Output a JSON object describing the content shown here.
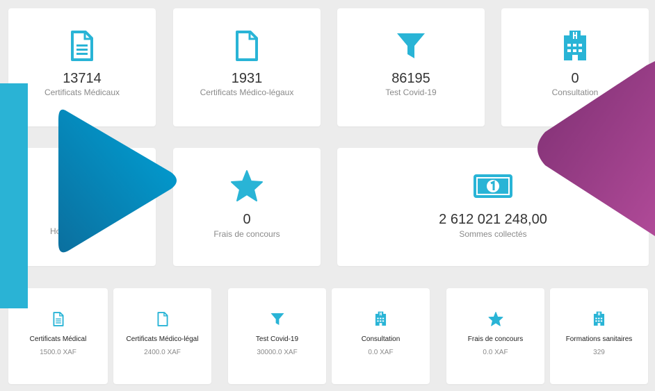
{
  "colors": {
    "accent": "#29b4d6",
    "blue_arrow": "#0088bb",
    "purple_arrow": "#9c3f86",
    "side_bar": "#2ab3d5"
  },
  "top_cards": [
    {
      "icon": "document-text-icon",
      "value": "13714",
      "label": "Certificats Médicaux"
    },
    {
      "icon": "document-icon",
      "value": "1931",
      "label": "Certificats Médico-légaux"
    },
    {
      "icon": "filter-icon",
      "value": "86195",
      "label": "Test Covid-19"
    },
    {
      "icon": "hospital-icon",
      "value": "0",
      "label": "Consultation"
    }
  ],
  "middle_cards": [
    {
      "label": "Ho"
    },
    {
      "icon": "star-icon",
      "value": "0",
      "label": "Frais de concours"
    },
    {
      "icon": "money-bill-icon",
      "value": "2 612 021 248,00",
      "label": "Sommes collectés"
    }
  ],
  "bottom_cards": [
    {
      "icon": "document-text-icon",
      "label": "Certificats Médical",
      "value": "1500.0 XAF"
    },
    {
      "icon": "document-icon",
      "label": "Certificats Médico-légal",
      "value": "2400.0 XAF"
    },
    {
      "icon": "filter-icon",
      "label": "Test Covid-19",
      "value": "30000.0 XAF"
    },
    {
      "icon": "hospital-icon",
      "label": "Consultation",
      "value": "0.0 XAF"
    },
    {
      "icon": "star-icon",
      "label": "Frais de concours",
      "value": "0.0 XAF"
    },
    {
      "icon": "hospital-icon",
      "label": "Formations sanitaires",
      "value": "329"
    }
  ]
}
